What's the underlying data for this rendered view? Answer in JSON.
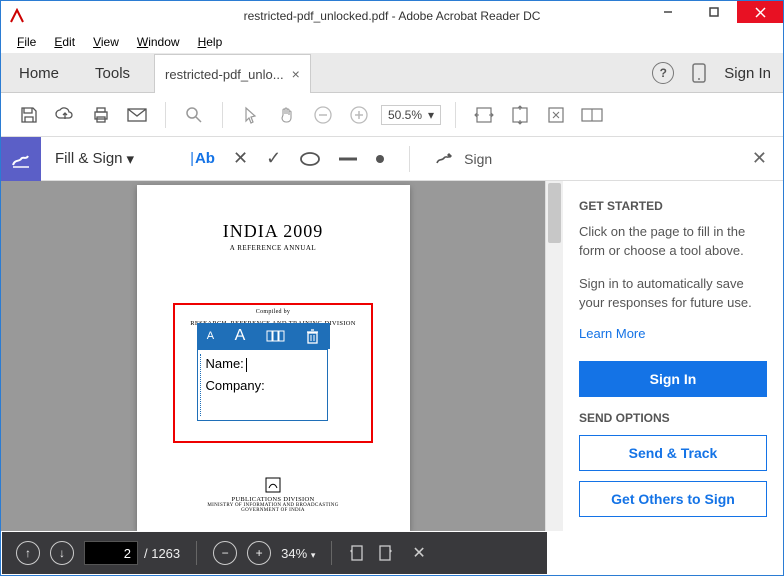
{
  "app": {
    "title": "restricted-pdf_unlocked.pdf - Adobe Acrobat Reader DC"
  },
  "menu": {
    "file": "File",
    "edit": "Edit",
    "view": "View",
    "window": "Window",
    "help": "Help"
  },
  "tabs": {
    "home": "Home",
    "tools": "Tools",
    "doc": "restricted-pdf_unlo...",
    "signin": "Sign In"
  },
  "toolbar": {
    "zoom": "50.5%"
  },
  "fillsign": {
    "label": "Fill & Sign",
    "ab": "Ab",
    "sign": "Sign"
  },
  "page": {
    "title": "INDIA  2009",
    "subtitle": "A REFERENCE ANNUAL",
    "compiled": "Compiled by",
    "publisher": "RESEARCH, REFERENCE AND TRAINING DIVISION",
    "footer1": "PUBLICATIONS  DIVISION",
    "footer2": "MINISTRY OF INFORMATION AND BROADCASTING",
    "footer3": "GOVERNMENT OF INDIA",
    "field1": "Name:",
    "field2": "Company:"
  },
  "rightpanel": {
    "head1": "GET STARTED",
    "p1": "Click on the page to fill in the form or choose a tool above.",
    "p2": "Sign in to automatically save your responses for future use.",
    "learn": "Learn More",
    "signin": "Sign In",
    "head2": "SEND OPTIONS",
    "send": "Send & Track",
    "others": "Get Others to Sign"
  },
  "bottom": {
    "page": "2",
    "total": "/ 1263",
    "zoom": "34%"
  }
}
